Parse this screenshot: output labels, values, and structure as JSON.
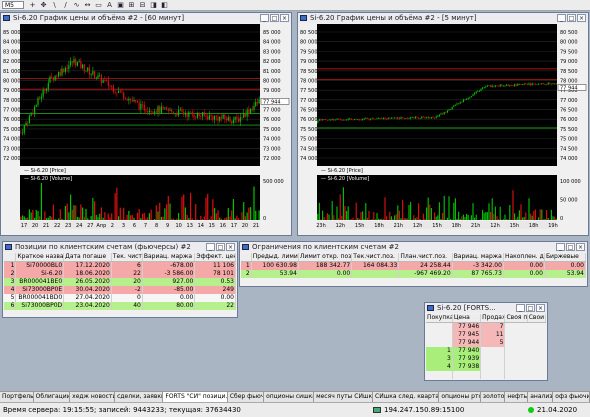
{
  "toolbar": {
    "timeframe": "M5",
    "tools": [
      "+",
      "✥",
      "\\",
      "/",
      "∿",
      "↔",
      "▭",
      "A",
      "▣",
      "⊞",
      "⊟",
      "◨",
      "◧"
    ]
  },
  "chart1": {
    "title": "Si-6.20 График цены и объёма #2 - [60 минут]",
    "price_label": "Si-6.20 [Price]",
    "volume_label": "Si-6.20 [Volume]",
    "price_ticks": [
      "85 000",
      "84 000",
      "83 000",
      "82 000",
      "81 000",
      "80 000",
      "79 000",
      "78 000",
      "77 000",
      "76 000",
      "75 000",
      "74 000",
      "73 000",
      "72 000"
    ],
    "last_price": "77 944",
    "vol_ticks": [
      "500 000",
      "0"
    ],
    "dates": [
      "17",
      "20",
      "21",
      "22",
      "23",
      "24",
      "27",
      "Апр",
      "2",
      "3",
      "6",
      "7",
      "8",
      "9",
      "10",
      "13",
      "14",
      "15",
      "16",
      "17",
      "20",
      "21"
    ]
  },
  "chart2": {
    "title": "Si-6.20 График цены и объёма #2 - [5 минут]",
    "price_label": "Si-6.20 [Price]",
    "volume_label": "Si-6.20 [Volume]",
    "price_ticks": [
      "80 500",
      "80 000",
      "79 500",
      "79 000",
      "78 500",
      "78 000",
      "77 500",
      "77 000",
      "76 500",
      "76 000",
      "75 500",
      "75 000",
      "74 500",
      "74 000"
    ],
    "last_price": "77 944",
    "vol_ticks": [
      "100 000",
      "50 000",
      "0"
    ],
    "dates": [
      "23h",
      "12h",
      "15h",
      "18h",
      "21h",
      "12h",
      "15h",
      "18h",
      "21h",
      "12h",
      "15h",
      "18h",
      "19h"
    ]
  },
  "positions": {
    "title": "Позиции по клиентским счетам (фьючерсы) #2",
    "columns": [
      "",
      "Краткое название",
      "Дата погаше",
      "Тек. чист",
      "Вариац. маржа",
      "Эффект. цен"
    ],
    "rows": [
      [
        "1",
        "Si70000BL0",
        "17.12.2020",
        "6",
        "-678.00",
        "11 106"
      ],
      [
        "2",
        "Si-6.20",
        "18.06.2020",
        "22",
        "-3 586.00",
        "78 101"
      ],
      [
        "3",
        "BR000041BE0",
        "26.05.2020",
        "20",
        "927.00",
        "0.53"
      ],
      [
        "4",
        "Si73000BP0E",
        "30.04.2020",
        "-2",
        "-85.00",
        "249"
      ],
      [
        "5",
        "BR000041BD0",
        "27.04.2020",
        "0",
        "0.00",
        "0.00"
      ],
      [
        "6",
        "Si73000BP0D",
        "23.04.2020",
        "40",
        "80.00",
        "22"
      ]
    ]
  },
  "limits": {
    "title": "Ограничения по клиентским счетам #2",
    "columns": [
      "",
      "Предыд. лимит",
      "Лимит откр. поз.",
      "Тек.чист.поз.",
      "План.чист.поз.",
      "Вариац. маржа",
      "Накоплен. д",
      "Биржевые"
    ],
    "rows": [
      [
        "1",
        "100 630.98",
        "188 342.77",
        "164 084.33",
        "24 258.44",
        "-3 342.00",
        "0.00",
        "0.00"
      ],
      [
        "2",
        "53.94",
        "0.00",
        "",
        "-967 469.20",
        "87 765.73",
        "0.00",
        "53.94"
      ]
    ]
  },
  "book": {
    "title": "Si-6.20 [FORTS...",
    "columns": [
      "Покупка",
      "Цена",
      "Продажа",
      "Своя по",
      "Свои"
    ],
    "rows": [
      [
        "",
        "77 946",
        "7"
      ],
      [
        "",
        "77 945",
        "11"
      ],
      [
        "",
        "77 944",
        "5"
      ],
      [
        "1",
        "77 940",
        ""
      ],
      [
        "3",
        "77 939",
        ""
      ],
      [
        "4",
        "77 938",
        ""
      ],
      [
        "",
        "",
        ""
      ]
    ]
  },
  "tabs": [
    "Портфель",
    "Облигации",
    "хедж новости",
    "сделки, заявки",
    "FORTS \"СИ\" позици...",
    "Сбер фьюч",
    "опционы сишка",
    "месяч путы СИшка",
    "СИшка след. квартал",
    "опционы ртс",
    "золото",
    "нефть",
    "анализ",
    "офз фьючи"
  ],
  "status": {
    "server": "Время сервера: 19:15:55; записей: 9443233; текущая: 37634430",
    "ip": "194.247.150.89:15100",
    "date": "21.04.2020"
  },
  "colors": {
    "up": "#00c400",
    "down": "#e01010",
    "pos_row": "#f5a8a8",
    "neg_row": "#b6f08c"
  }
}
